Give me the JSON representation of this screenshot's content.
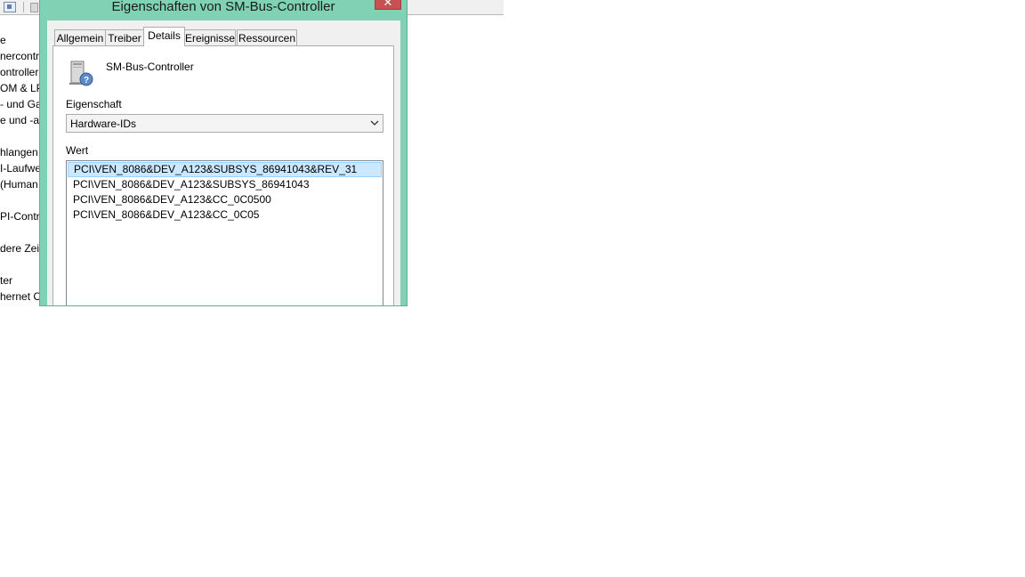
{
  "background_window": {
    "tree_items": [
      "e",
      "nercontro",
      "ontroller",
      "OM & LP",
      "- und Ga",
      "e und -a",
      "hlangen",
      "I-Laufwe",
      "(Human",
      "PI-Contro",
      "dere Zei",
      "ter",
      "hernet Co"
    ]
  },
  "dialog": {
    "title": "Eigenschaften von SM-Bus-Controller",
    "close_glyph": "✕",
    "tabs": [
      "Allgemein",
      "Treiber",
      "Details",
      "Ereignisse",
      "Ressourcen"
    ],
    "active_tab": "Details",
    "device_name": "SM-Bus-Controller",
    "property_label": "Eigenschaft",
    "property_value": "Hardware-IDs",
    "value_label": "Wert",
    "values": [
      "PCI\\VEN_8086&DEV_A123&SUBSYS_86941043&REV_31",
      "PCI\\VEN_8086&DEV_A123&SUBSYS_86941043",
      "PCI\\VEN_8086&DEV_A123&CC_0C0500",
      "PCI\\VEN_8086&DEV_A123&CC_0C05"
    ],
    "selected_value_index": 0
  },
  "colors": {
    "title_bar": "#7fd3b4",
    "close_button": "#c75050",
    "selection": "#cce8ff"
  }
}
